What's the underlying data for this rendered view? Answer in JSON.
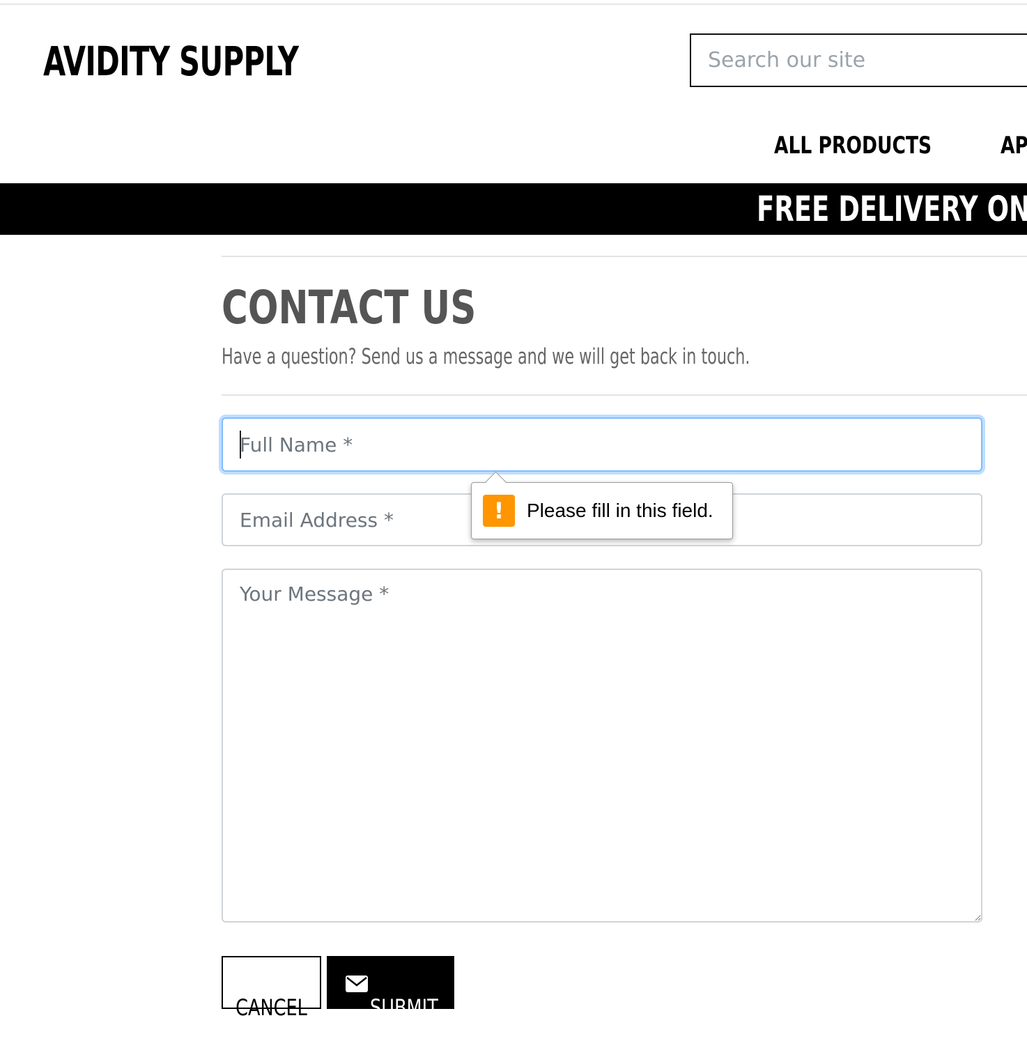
{
  "header": {
    "brand": "AVIDITY SUPPLY",
    "search_placeholder": "Search our site"
  },
  "nav": {
    "items": [
      {
        "label": "ALL PRODUCTS"
      },
      {
        "label": "APP"
      }
    ]
  },
  "banner": {
    "text": "FREE DELIVERY ON ORDERS"
  },
  "contact": {
    "title": "CONTACT US",
    "subtitle": "Have a question? Send us a message and we will get back in touch.",
    "fields": {
      "name_placeholder": "Full Name *",
      "email_placeholder": "Email Address *",
      "message_placeholder": "Your Message *"
    },
    "validation_message": "Please fill in this field.",
    "cancel_label": "CANCEL",
    "submit_label": "SUBMIT"
  },
  "colors": {
    "brand_black": "#000000",
    "focus_blue": "#80bdff",
    "warning_orange": "#ff9500",
    "muted_text": "#6c757d"
  },
  "icons": {
    "warning": "warning-icon",
    "submit": "envelope-icon"
  }
}
